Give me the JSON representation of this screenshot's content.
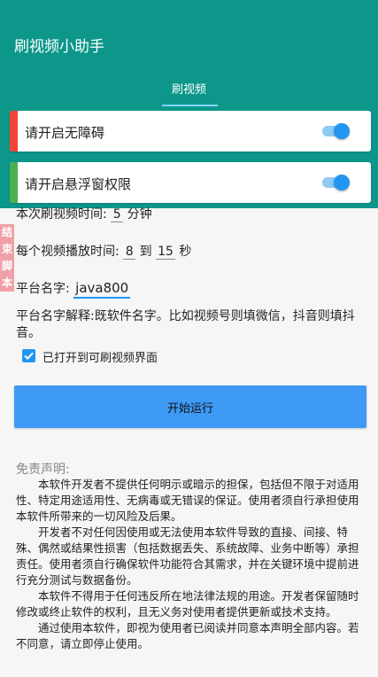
{
  "app": {
    "title": "刷视频小助手",
    "tab": "刷视频",
    "accent": "#0d978b",
    "switch_color": "#2196f3"
  },
  "permissions": [
    {
      "label": "请开启无障碍",
      "bar_color": "#f44336",
      "enabled": true
    },
    {
      "label": "请开启悬浮窗权限",
      "bar_color": "#4caf50",
      "enabled": true
    }
  ],
  "settings": {
    "duration_prefix": "本次刷视频时间:",
    "duration_value": "5",
    "duration_unit": "分钟",
    "play_prefix": "每个视频播放时间:",
    "play_min": "8",
    "play_to": "到",
    "play_max": "15",
    "play_unit": "秒",
    "platform_label": "平台名字:",
    "platform_value": "java800",
    "platform_desc": "平台名字解释:既软件名字。比如视频号则填微信，抖音则填抖音。",
    "checkbox_label": "已打开到可刷视频界面",
    "checkbox_checked": true
  },
  "start_button": "开始运行",
  "float_button": "结束脚本",
  "disclaimer": {
    "title": "免责声明:",
    "paragraphs": [
      "本软件开发者不提供任何明示或暗示的担保，包括但不限于对适用性、特定用途适用性、无病毒或无错误的保证。使用者须自行承担使用本软件所带来的一切风险及后果。",
      "开发者不对任何因使用或无法使用本软件导致的直接、间接、特殊、偶然或结果性损害（包括数据丢失、系统故障、业务中断等）承担责任。使用者须自行确保软件功能符合其需求，并在关键环境中提前进行充分测试与数据备份。",
      "本软件不得用于任何违反所在地法律法规的用途。开发者保留随时修改或终止软件的权利，且无义务对使用者提供更新或技术支持。",
      "通过使用本软件，即视为使用者已阅读并同意本声明全部内容。若不同意，请立即停止使用。"
    ]
  }
}
